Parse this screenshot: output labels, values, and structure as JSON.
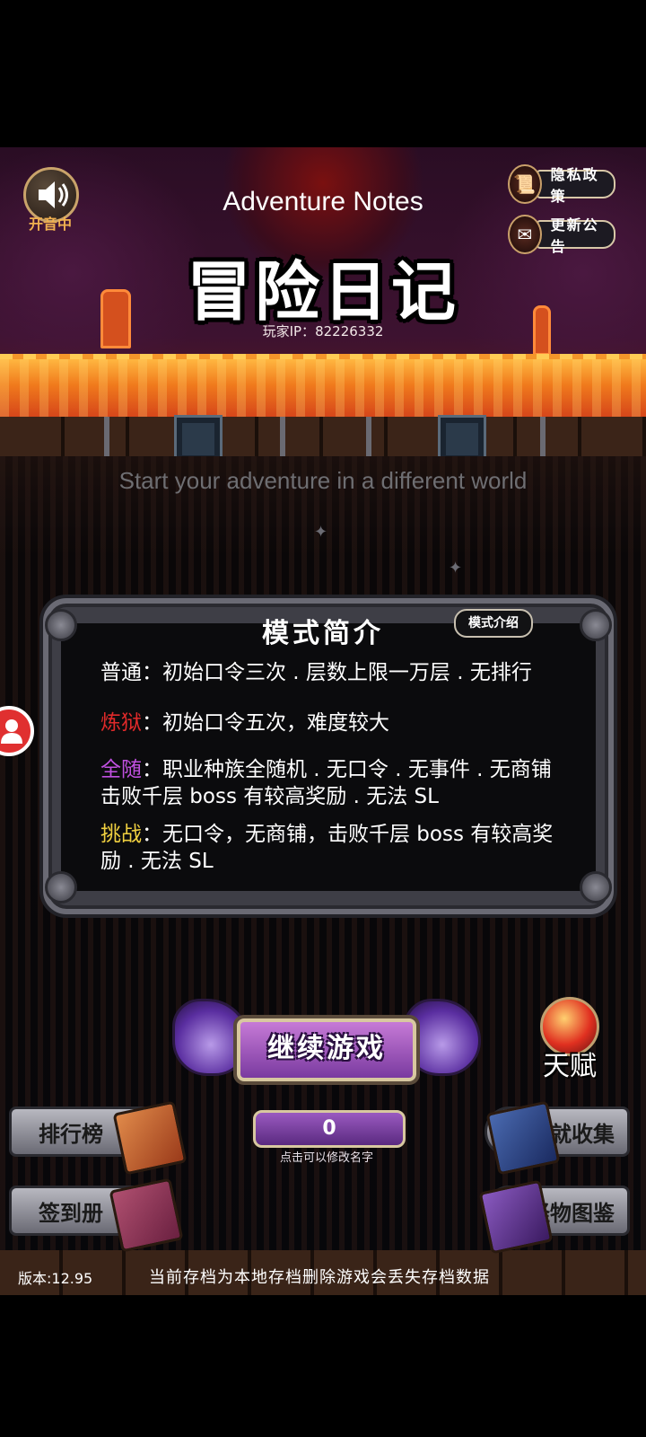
{
  "header": {
    "sound_label": "开音中",
    "privacy_label": "隐私政策",
    "notice_label": "更新公告",
    "title_en": "Adventure Notes",
    "title_cn": "冒险日记",
    "player_ip_label": "玩家IP：",
    "player_ip": "82226332",
    "tagline": "Start your adventure in a different world"
  },
  "mode_panel": {
    "title": "模式简介",
    "intro_button": "模式介绍",
    "modes": [
      {
        "name": "普通",
        "color": "#ffffff",
        "desc": "：初始口令三次 . 层数上限一万层 . 无排行"
      },
      {
        "name": "炼狱",
        "color": "#e02a2a",
        "desc": "：初始口令五次，难度较大"
      },
      {
        "name": "全随",
        "color": "#c050e0",
        "desc": "：职业种族全随机 . 无口令 . 无事件 . 无商铺击败千层 boss 有较高奖励 . 无法 SL"
      },
      {
        "name": "挑战",
        "color": "#f0d040",
        "desc": "：无口令，无商铺，击败千层 boss 有较高奖励 . 无法 SL"
      }
    ]
  },
  "actions": {
    "continue": "继续游戏",
    "talent": "天赋",
    "ranking": "排行榜",
    "checkin": "签到册",
    "achievements": "成就收集",
    "monsters": "怪物图鉴",
    "player_name": "0",
    "name_hint": "点击可以修改名字"
  },
  "footer": {
    "version": "版本:12.95",
    "notice": "当前存档为本地存档删除游戏会丢失存档数据"
  },
  "icons": {
    "sound": "speaker-icon",
    "privacy": "scroll-icon",
    "notice": "envelope-icon",
    "avatar": "user-icon"
  }
}
